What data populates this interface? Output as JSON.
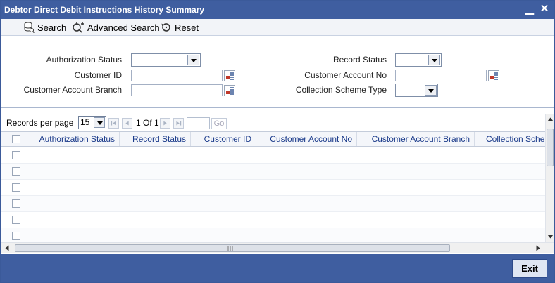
{
  "window": {
    "title": "Debtor Direct Debit Instructions History Summary",
    "minimize_glyph": "▁",
    "close_glyph": "✕"
  },
  "toolbar": {
    "search_label": "Search",
    "advanced_search_label": "Advanced Search",
    "reset_label": "Reset"
  },
  "criteria": {
    "authorization_status_label": "Authorization Status",
    "authorization_status_value": "",
    "record_status_label": "Record Status",
    "record_status_value": "",
    "customer_id_label": "Customer ID",
    "customer_id_value": "",
    "customer_account_no_label": "Customer Account No",
    "customer_account_no_value": "",
    "customer_account_branch_label": "Customer Account Branch",
    "customer_account_branch_value": "",
    "collection_scheme_type_label": "Collection Scheme Type",
    "collection_scheme_type_value": ""
  },
  "pager": {
    "records_per_page_label": "Records per page",
    "records_per_page_value": "15",
    "page_indicator": "1 Of 1",
    "go_label": "Go"
  },
  "table": {
    "columns": [
      "Authorization Status",
      "Record Status",
      "Customer ID",
      "Customer Account No",
      "Customer Account Branch",
      "Collection Sche"
    ],
    "row_count": 6
  },
  "footer": {
    "exit_label": "Exit"
  },
  "colors": {
    "title_bar": "#3f5ea0",
    "header_text": "#1a3a8a",
    "lov_icon": "#c0392b"
  },
  "icons": {
    "search": "search-icon",
    "advanced_search": "advanced-search-icon",
    "reset": "reset-icon",
    "lov": "list-of-values-icon"
  }
}
